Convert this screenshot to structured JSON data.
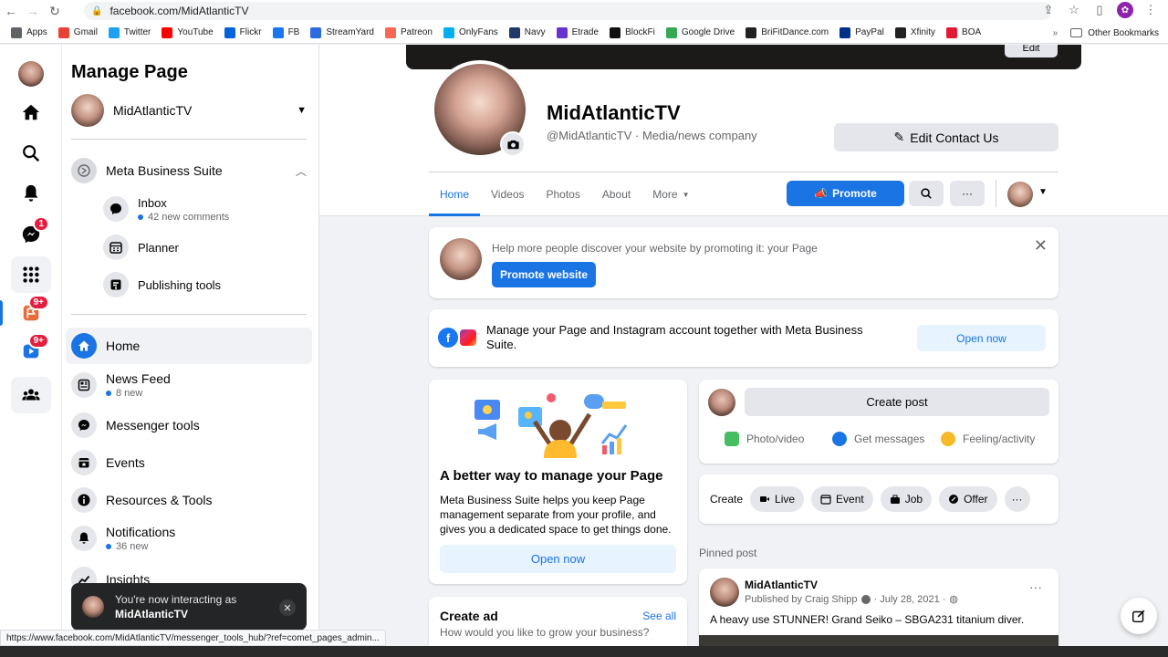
{
  "browser": {
    "url": "facebook.com/MidAtlanticTV",
    "status_url": "https://www.facebook.com/MidAtlanticTV/messenger_tools_hub/?ref=comet_pages_admin...",
    "bookmarks": [
      {
        "label": "Apps",
        "color": "#5f6368"
      },
      {
        "label": "Gmail",
        "color": "#ea4335"
      },
      {
        "label": "Twitter",
        "color": "#1da1f2"
      },
      {
        "label": "YouTube",
        "color": "#ff0000"
      },
      {
        "label": "Flickr",
        "color": "#0063dc"
      },
      {
        "label": "FB",
        "color": "#1877f2"
      },
      {
        "label": "StreamYard",
        "color": "#2d6cdf"
      },
      {
        "label": "Patreon",
        "color": "#f96854"
      },
      {
        "label": "OnlyFans",
        "color": "#00aff0"
      },
      {
        "label": "Navy",
        "color": "#1f3a68"
      },
      {
        "label": "Etrade",
        "color": "#6633cc"
      },
      {
        "label": "BlockFi",
        "color": "#111111"
      },
      {
        "label": "Google Drive",
        "color": "#34a853"
      },
      {
        "label": "BriFitDance.com",
        "color": "#222222"
      },
      {
        "label": "PayPal",
        "color": "#003087"
      },
      {
        "label": "Xfinity",
        "color": "#222222"
      },
      {
        "label": "BOA",
        "color": "#e31837"
      }
    ],
    "other_bookmarks": "Other Bookmarks",
    "more_chevron": "»"
  },
  "rail": {
    "messenger_badge": "1",
    "flag_badge": "9+",
    "video_badge": "9+"
  },
  "sidebar": {
    "title": "Manage Page",
    "page_name": "MidAtlanticTV",
    "mbs_label": "Meta Business Suite",
    "mbs_items": [
      {
        "label": "Inbox",
        "sub": "42 new comments"
      },
      {
        "label": "Planner"
      },
      {
        "label": "Publishing tools"
      }
    ],
    "nav": {
      "home": "Home",
      "news_feed": "News Feed",
      "news_feed_sub": "8 new",
      "messenger_tools": "Messenger tools",
      "events": "Events",
      "resources": "Resources & Tools",
      "notifications": "Notifications",
      "notifications_sub": "36 new",
      "insights": "Insights"
    },
    "toast": {
      "line1": "You're now interacting as",
      "line2": "MidAtlanticTV",
      "close": "✕"
    }
  },
  "header": {
    "cover_edit": "Edit",
    "page_name": "MidAtlanticTV",
    "handle": "@MidAtlanticTV · Media/news company",
    "edit_contact": "Edit Contact Us",
    "tabs": [
      "Home",
      "Videos",
      "Photos",
      "About",
      "More"
    ],
    "promote": "Promote",
    "more_dots": "···"
  },
  "promo_card": {
    "text": "Help more people discover your website by promoting it: your Page",
    "button": "Promote website"
  },
  "mbs_card": {
    "text": "Manage your Page and Instagram account together with Meta Business Suite.",
    "button": "Open now"
  },
  "better_card": {
    "title": "A better way to manage your Page",
    "body": "Meta Business Suite helps you keep Page management separate from your profile, and gives you a dedicated space to get things done.",
    "button": "Open now"
  },
  "create_ad": {
    "title": "Create ad",
    "see_all": "See all",
    "sub": "How would you like to grow your business?"
  },
  "composer": {
    "create_post": "Create post",
    "photo_video": "Photo/video",
    "get_messages": "Get messages",
    "feeling": "Feeling/activity"
  },
  "create_row": {
    "label": "Create",
    "pills": [
      "Live",
      "Event",
      "Job",
      "Offer"
    ],
    "more": "···"
  },
  "pinned": {
    "heading": "Pinned post",
    "author": "MidAtlanticTV",
    "meta": "Published by Craig Shipp",
    "date": "· July 28, 2021 ·",
    "text": "A heavy use STUNNER! Grand Seiko – SBGA231 titanium diver.",
    "more": "···"
  }
}
